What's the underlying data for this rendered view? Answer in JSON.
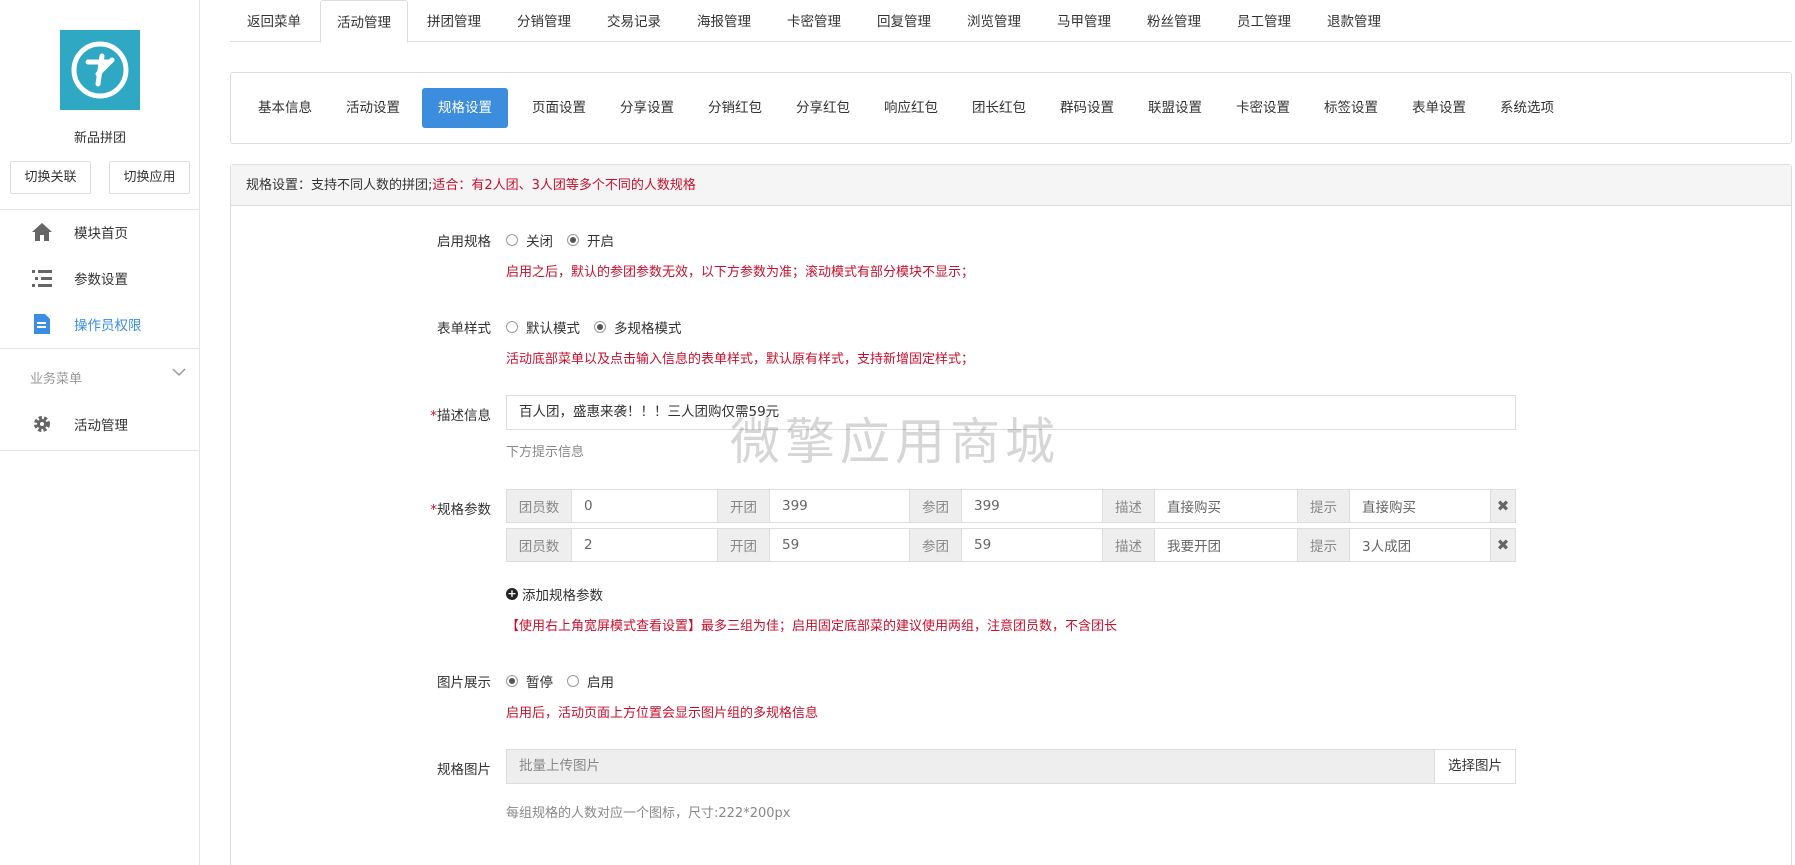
{
  "sidebar": {
    "app_name": "新品拼团",
    "switch_buttons": [
      "切换关联",
      "切换应用"
    ],
    "items": [
      {
        "label": "模块首页",
        "icon": "home-icon"
      },
      {
        "label": "参数设置",
        "icon": "list-icon"
      },
      {
        "label": "操作员权限",
        "icon": "document-icon",
        "active": true
      }
    ],
    "group_label": "业务菜单",
    "group_items": [
      {
        "label": "活动管理",
        "icon": "gear-icon"
      }
    ]
  },
  "top_tabs": [
    "返回菜单",
    "活动管理",
    "拼团管理",
    "分销管理",
    "交易记录",
    "海报管理",
    "卡密管理",
    "回复管理",
    "浏览管理",
    "马甲管理",
    "粉丝管理",
    "员工管理",
    "退款管理"
  ],
  "top_tab_active": "活动管理",
  "sub_tabs": [
    "基本信息",
    "活动设置",
    "规格设置",
    "页面设置",
    "分享设置",
    "分销红包",
    "分享红包",
    "响应红包",
    "团长红包",
    "群码设置",
    "联盟设置",
    "卡密设置",
    "标签设置",
    "表单设置",
    "系统选项"
  ],
  "sub_tab_active": "规格设置",
  "panel": {
    "heading": "规格设置：支持不同人数的拼团;",
    "heading_red": "适合：有2人团、3人团等多个不同的人数规格"
  },
  "form": {
    "enable_spec": {
      "label": "启用规格",
      "options": [
        "关闭",
        "开启"
      ],
      "selected": "开启",
      "hint": "启用之后，默认的参团参数无效，以下方参数为准；滚动模式有部分模块不显示；"
    },
    "form_style": {
      "label": "表单样式",
      "options": [
        "默认模式",
        "多规格模式"
      ],
      "selected": "多规格模式",
      "hint": "活动底部菜单以及点击输入信息的表单样式，默认原有样式，支持新增固定样式；"
    },
    "description": {
      "label": "描述信息",
      "value": "百人团，盛惠来袭！！！三人团购仅需59元",
      "hint": "下方提示信息"
    },
    "spec_params": {
      "label": "规格参数",
      "field_labels": {
        "members": "团员数",
        "open": "开团",
        "join": "参团",
        "desc": "描述",
        "tip": "提示"
      },
      "rows": [
        {
          "members": "0",
          "open": "399",
          "join": "399",
          "desc": "直接购买",
          "tip": "直接购买"
        },
        {
          "members": "2",
          "open": "59",
          "join": "59",
          "desc": "我要开团",
          "tip": "3人成团"
        }
      ],
      "add_label": "添加规格参数",
      "hint": "【使用右上角宽屏模式查看设置】最多三组为佳；启用固定底部菜的建议使用两组，注意团员数，不含团长"
    },
    "image_display": {
      "label": "图片展示",
      "options": [
        "暂停",
        "启用"
      ],
      "selected": "暂停",
      "hint": "启用后，活动页面上方位置会显示图片组的多规格信息"
    },
    "spec_image": {
      "label": "规格图片",
      "placeholder": "批量上传图片",
      "button": "选择图片",
      "hint": "每组规格的人数对应一个图标，尺寸:222*200px"
    }
  },
  "watermark": "微擎应用商城",
  "colors": {
    "accent": "#3c8dde",
    "danger": "#c8102e",
    "logo": "#2fa8c4"
  }
}
